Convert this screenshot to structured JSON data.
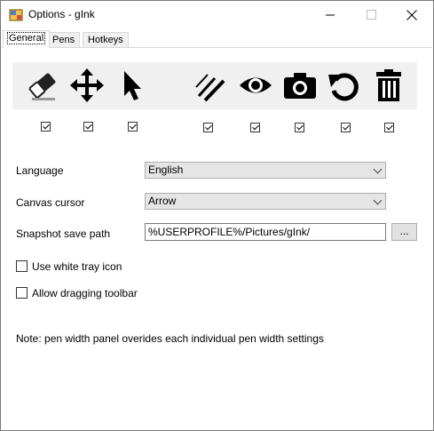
{
  "window": {
    "title": "Options - gInk",
    "minimize": "—",
    "maximize": "☐",
    "close": "✕"
  },
  "tabs": [
    {
      "label": "General"
    },
    {
      "label": "Pens"
    },
    {
      "label": "Hotkeys"
    }
  ],
  "tools": [
    {
      "name": "eraser-icon",
      "checked": true
    },
    {
      "name": "pan-icon",
      "checked": true
    },
    {
      "name": "pointer-icon",
      "checked": true
    },
    {
      "name": "pen-width-icon",
      "checked": true
    },
    {
      "name": "visibility-icon",
      "checked": true
    },
    {
      "name": "snapshot-icon",
      "checked": true
    },
    {
      "name": "undo-icon",
      "checked": true
    },
    {
      "name": "clear-icon",
      "checked": true
    }
  ],
  "settings": {
    "language_label": "Language",
    "language_value": "English",
    "cursor_label": "Canvas cursor",
    "cursor_value": "Arrow",
    "snapshot_label": "Snapshot save path",
    "snapshot_value": "%USERPROFILE%/Pictures/gInk/",
    "browse_label": "...",
    "white_tray_label": "Use white tray icon",
    "white_tray_checked": false,
    "drag_toolbar_label": "Allow dragging toolbar",
    "drag_toolbar_checked": false,
    "note": "Note: pen width panel overides each individual pen width settings"
  }
}
